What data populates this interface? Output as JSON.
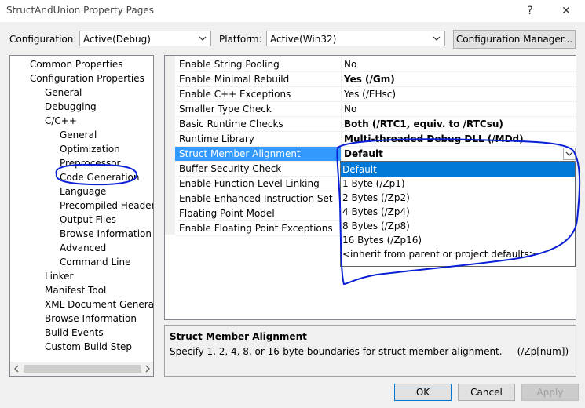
{
  "window": {
    "title": "StructAndUnion Property Pages",
    "help_glyph": "?",
    "close_glyph": "✕"
  },
  "toolbar": {
    "configuration_label": "Configuration:",
    "configuration_value": "Active(Debug)",
    "platform_label": "Platform:",
    "platform_value": "Active(Win32)",
    "config_manager_label": "Configuration Manager..."
  },
  "tree": {
    "items": [
      {
        "label": "Common Properties"
      },
      {
        "label": "Configuration Properties"
      },
      {
        "label": "General"
      },
      {
        "label": "Debugging"
      },
      {
        "label": "C/C++"
      },
      {
        "label": "General"
      },
      {
        "label": "Optimization"
      },
      {
        "label": "Preprocessor"
      },
      {
        "label": "Code Generation"
      },
      {
        "label": "Language"
      },
      {
        "label": "Precompiled Headers"
      },
      {
        "label": "Output Files"
      },
      {
        "label": "Browse Information"
      },
      {
        "label": "Advanced"
      },
      {
        "label": "Command Line"
      },
      {
        "label": "Linker"
      },
      {
        "label": "Manifest Tool"
      },
      {
        "label": "XML Document Generator"
      },
      {
        "label": "Browse Information"
      },
      {
        "label": "Build Events"
      },
      {
        "label": "Custom Build Step"
      }
    ]
  },
  "grid": {
    "rows": [
      {
        "name": "Enable String Pooling",
        "value": "No"
      },
      {
        "name": "Enable Minimal Rebuild",
        "value": "Yes (/Gm)"
      },
      {
        "name": "Enable C++ Exceptions",
        "value": "Yes (/EHsc)"
      },
      {
        "name": "Smaller Type Check",
        "value": "No"
      },
      {
        "name": "Basic Runtime Checks",
        "value": "Both (/RTC1, equiv. to /RTCsu)"
      },
      {
        "name": "Runtime Library",
        "value": "Multi-threaded Debug DLL (/MDd)"
      },
      {
        "name": "Struct Member Alignment",
        "value": "Default"
      },
      {
        "name": "Buffer Security Check",
        "value": ""
      },
      {
        "name": "Enable Function-Level Linking",
        "value": ""
      },
      {
        "name": "Enable Enhanced Instruction Set",
        "value": ""
      },
      {
        "name": "Floating Point Model",
        "value": ""
      },
      {
        "name": "Enable Floating Point Exceptions",
        "value": ""
      }
    ]
  },
  "dropdown": {
    "options": [
      {
        "label": "Default"
      },
      {
        "label": "1 Byte (/Zp1)"
      },
      {
        "label": "2 Bytes (/Zp2)"
      },
      {
        "label": "4 Bytes (/Zp4)"
      },
      {
        "label": "8 Bytes (/Zp8)"
      },
      {
        "label": "16 Bytes (/Zp16)"
      },
      {
        "label": "<inherit from parent or project defaults>"
      }
    ]
  },
  "description": {
    "title": "Struct Member Alignment",
    "text": "Specify 1, 2, 4, 8, or 16-byte boundaries for struct member alignment.     (/Zp[num])"
  },
  "buttons": {
    "ok": "OK",
    "cancel": "Cancel",
    "apply": "Apply"
  },
  "colors": {
    "selection": "#0078d7",
    "annotation_ink": "#0a1fd6"
  }
}
